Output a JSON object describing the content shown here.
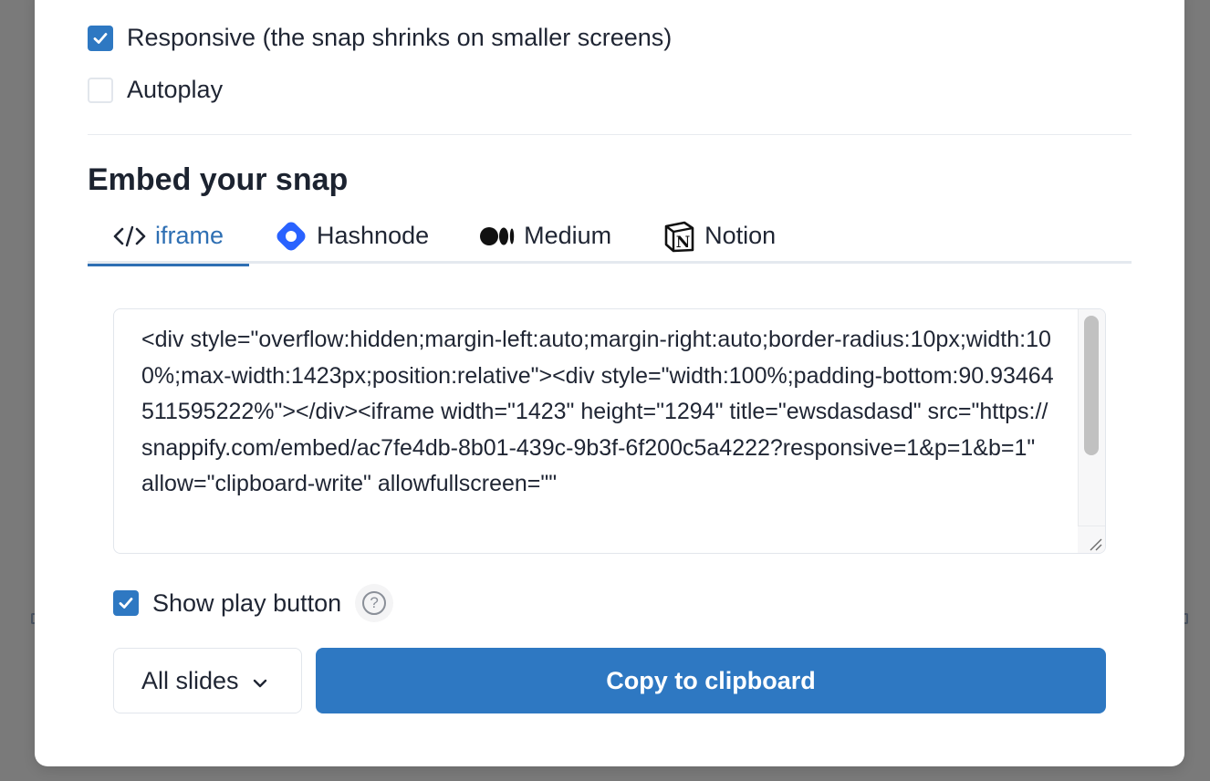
{
  "options": {
    "responsive": {
      "label": "Responsive (the snap shrinks on smaller screens)",
      "checked": true
    },
    "autoplay": {
      "label": "Autoplay",
      "checked": false
    }
  },
  "embed": {
    "title": "Embed your snap",
    "tabs": [
      {
        "label": "iframe",
        "icon": "code-icon",
        "active": true
      },
      {
        "label": "Hashnode",
        "icon": "hashnode-logo-icon",
        "active": false
      },
      {
        "label": "Medium",
        "icon": "medium-logo-icon",
        "active": false
      },
      {
        "label": "Notion",
        "icon": "notion-logo-icon",
        "active": false
      }
    ],
    "code": "<div style=\"overflow:hidden;margin-left:auto;margin-right:auto;border-radius:10px;width:100%;max-width:1423px;position:relative\"><div style=\"width:100%;padding-bottom:90.93464511595222%\"></div><iframe width=\"1423\" height=\"1294\" title=\"ewsdasdasd\" src=\"https://snappify.com/embed/ac7fe4db-8b01-439c-9b3f-6f200c5a4222?responsive=1&p=1&b=1\" allow=\"clipboard-write\" allowfullscreen=\"\"",
    "show_play_button": {
      "label": "Show play button",
      "checked": true
    },
    "help_icon": "question-circle-icon",
    "slides_select": {
      "value": "All slides"
    },
    "copy_button": "Copy to clipboard"
  },
  "colors": {
    "accent": "#2e78c2",
    "tab_active": "#2e6fb3",
    "hashnode": "#2962ff",
    "overlay": "#7a7a7a"
  }
}
